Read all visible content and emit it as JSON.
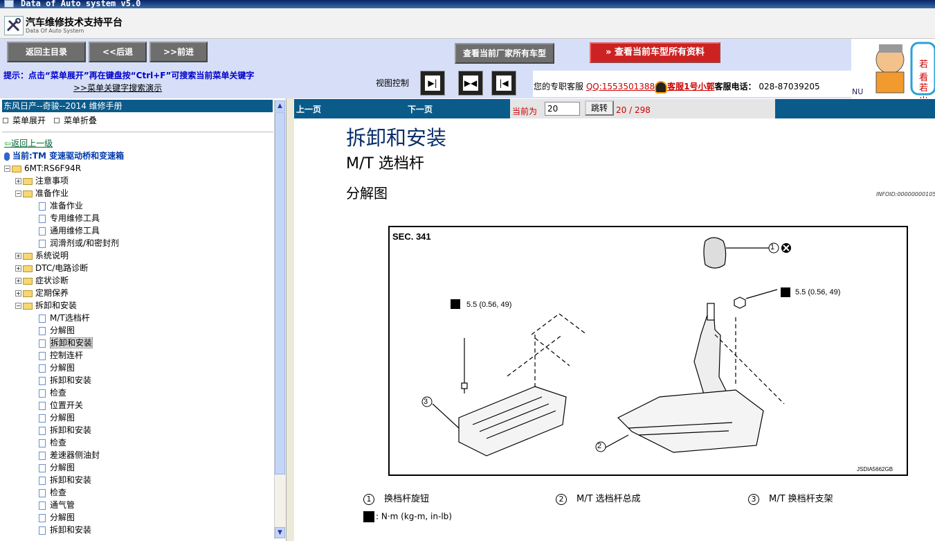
{
  "window": {
    "title": "Data of Auto system v5.0"
  },
  "app": {
    "title": "汽车维修技术支持平台",
    "subtitle": "Data Of Auto System"
  },
  "toolbar": {
    "home": "返回主目录",
    "back": "<<后退",
    "forward": ">>前进",
    "maker_models": "查看当前厂家所有车型",
    "model_all": "查看当前车型所有资料",
    "tip": "提示：点击“菜单展开”再在键盘按“Ctrl+F”可搜索当前菜单关键字",
    "search_demo": ">>菜单关键字搜索演示",
    "view_control": "视图控制"
  },
  "service": {
    "prefix": "您的专职客服",
    "qq": "QQ:1553501388",
    "name": "客服1号小郭",
    "phone_label": "客服电话：",
    "phone": "028-87039205"
  },
  "banner": {
    "nu": "NU",
    "t1": "若看",
    "t2": "若出"
  },
  "tree": {
    "header": "东风日产--奇骏--2014 维修手册",
    "expand": "菜单展开",
    "collapse": "菜单折叠",
    "up": "返回上一级",
    "current": "当前:TM 变速驱动桥和变速箱",
    "root": "6MT:RS6F94R",
    "nodes": [
      {
        "label": "注意事项",
        "type": "folder",
        "level": 1,
        "open": false
      },
      {
        "label": "准备作业",
        "type": "folder",
        "level": 1,
        "open": true
      },
      {
        "label": "准备作业",
        "type": "doc",
        "level": 2
      },
      {
        "label": "专用维修工具",
        "type": "doc",
        "level": 2
      },
      {
        "label": "通用维修工具",
        "type": "doc",
        "level": 2
      },
      {
        "label": "润滑剂或/和密封剂",
        "type": "doc",
        "level": 2
      },
      {
        "label": "系统说明",
        "type": "folder",
        "level": 1,
        "open": false
      },
      {
        "label": "DTC/电路诊断",
        "type": "folder",
        "level": 1,
        "open": false
      },
      {
        "label": "症状诊断",
        "type": "folder",
        "level": 1,
        "open": false
      },
      {
        "label": "定期保养",
        "type": "folder",
        "level": 1,
        "open": false
      },
      {
        "label": "拆卸和安装",
        "type": "folder",
        "level": 1,
        "open": true
      },
      {
        "label": "M/T选档杆",
        "type": "doc",
        "level": 2
      },
      {
        "label": "分解图",
        "type": "doc",
        "level": 2
      },
      {
        "label": "拆卸和安装",
        "type": "doc",
        "level": 2,
        "selected": true
      },
      {
        "label": "控制连杆",
        "type": "doc",
        "level": 2
      },
      {
        "label": "分解图",
        "type": "doc",
        "level": 2
      },
      {
        "label": "拆卸和安装",
        "type": "doc",
        "level": 2
      },
      {
        "label": "检查",
        "type": "doc",
        "level": 2
      },
      {
        "label": "位置开关",
        "type": "doc",
        "level": 2
      },
      {
        "label": "分解图",
        "type": "doc",
        "level": 2
      },
      {
        "label": "拆卸和安装",
        "type": "doc",
        "level": 2
      },
      {
        "label": "检查",
        "type": "doc",
        "level": 2
      },
      {
        "label": "差速器侧油封",
        "type": "doc",
        "level": 2
      },
      {
        "label": "分解图",
        "type": "doc",
        "level": 2
      },
      {
        "label": "拆卸和安装",
        "type": "doc",
        "level": 2
      },
      {
        "label": "检查",
        "type": "doc",
        "level": 2
      },
      {
        "label": "通气管",
        "type": "doc",
        "level": 2
      },
      {
        "label": "分解图",
        "type": "doc",
        "level": 2
      },
      {
        "label": "拆卸和安装",
        "type": "doc",
        "level": 2
      }
    ]
  },
  "pager": {
    "prev": "上一页",
    "next": "下一页",
    "current_label": "当前为",
    "current_value": "20",
    "jump": "跳转",
    "count": "20 / 298"
  },
  "document": {
    "h1": "拆卸和安装",
    "h2": "M/T 选档杆",
    "h3": "分解图",
    "infoid": "INFOID:00000000105",
    "sec": "SEC. 341",
    "torque1": "5.5 (0.56, 49)",
    "torque2": "5.5 (0.56, 49)",
    "fig_id": "JSDIA5662GB",
    "n1": "1",
    "n2": "2",
    "n3": "3",
    "legend1": "换档杆旋钮",
    "legend2": "M/T 选档杆总成",
    "legend3": "M/T 换档杆支架",
    "unit": ": N·m (kg-m, in-lb)"
  }
}
